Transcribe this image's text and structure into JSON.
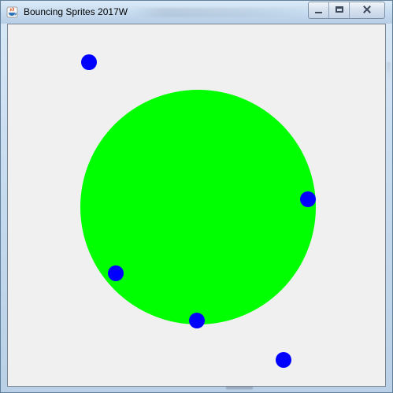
{
  "window": {
    "title": "Bouncing Sprites 2017W"
  },
  "icons": {
    "app": "java-icon",
    "minimize": "minimize-icon",
    "maximize": "maximize-icon",
    "close": "close-icon"
  },
  "colors": {
    "canvas_background": "#f0f0f0",
    "sprite": "#0000ff",
    "target_circle": "#00ff00"
  }
}
